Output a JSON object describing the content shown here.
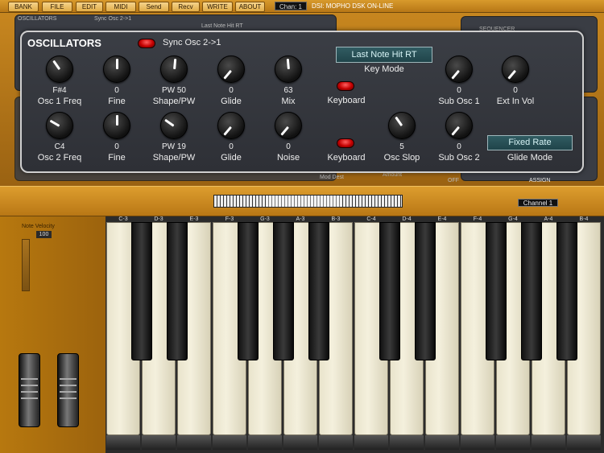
{
  "toolbar": {
    "buttons": [
      "BANK",
      "FILE",
      "EDIT",
      "MIDI",
      "Send",
      "Recv",
      "WRITE",
      "ABOUT"
    ],
    "channel": "Chan: 1",
    "status": "DSI:  MOPHO DSK ON-LINE"
  },
  "background": {
    "oscillators": "OSCILLATORS",
    "sync": "Sync Osc 2->1",
    "sequencer": "SEQUENCER",
    "assign": "ASSIGN",
    "mod_dest": "Mod Dest",
    "amount": "Amount",
    "off": "OFF",
    "last_note": "Last Note Hit RT"
  },
  "panel": {
    "title": "OSCILLATORS",
    "sync_label": "Sync Osc 2->1",
    "row1": [
      {
        "value": "F#4",
        "label": "Osc 1 Freq"
      },
      {
        "value": "0",
        "label": "Fine"
      },
      {
        "value": "PW 50",
        "label": "Shape/PW"
      },
      {
        "value": "0",
        "label": "Glide"
      },
      {
        "value": "63",
        "label": "Mix"
      },
      {
        "value": "0",
        "label": "Sub Osc 1"
      },
      {
        "value": "0",
        "label": "Ext In Vol"
      }
    ],
    "row2": [
      {
        "value": "C4",
        "label": "Osc 2 Freq"
      },
      {
        "value": "0",
        "label": "Fine"
      },
      {
        "value": "PW 19",
        "label": "Shape/PW"
      },
      {
        "value": "0",
        "label": "Glide"
      },
      {
        "value": "0",
        "label": "Noise"
      },
      {
        "value": "5",
        "label": "Osc Slop"
      },
      {
        "value": "0",
        "label": "Sub Osc 2"
      }
    ],
    "keyboard1": "Keyboard",
    "keyboard2": "Keyboard",
    "key_mode_value": "Last Note Hit RT",
    "key_mode_label": "Key Mode",
    "glide_mode_value": "Fixed Rate",
    "glide_mode_label": "Glide Mode"
  },
  "keyboard": {
    "channel": "Channel  1",
    "note_velocity_label": "Note Velocity",
    "note_velocity_value": "100",
    "key_labels": [
      "C-3",
      "D-3",
      "E-3",
      "F-3",
      "G-3",
      "A-3",
      "B-3",
      "C-4",
      "D-4",
      "E-4",
      "F-4",
      "G-4",
      "A-4",
      "B-4"
    ]
  },
  "colors": {
    "accent_orange": "#c98b22",
    "panel_dark": "#33363c",
    "led_red": "#e00000",
    "lcd_teal": "#2a5057"
  }
}
